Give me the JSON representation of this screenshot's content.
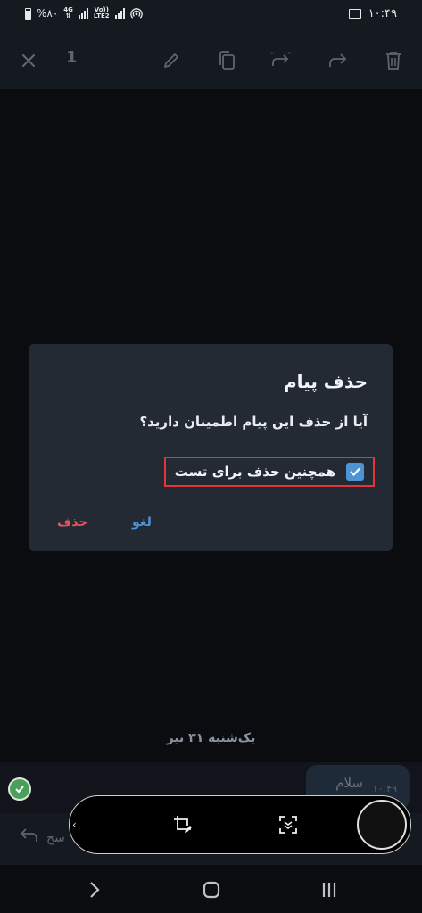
{
  "status_bar": {
    "battery": "%۸۰",
    "network_top": "4G",
    "network_bottom": "",
    "volte_top": "Vo))",
    "volte_bottom": "LTE2",
    "time": "۱۰:۴۹"
  },
  "action_bar": {
    "selection_count": "1"
  },
  "chat": {
    "date_label": "یک‌شنبه ۳۱ تیر",
    "message_text": "سلام",
    "message_time": "۱۰:۴۹",
    "reply_label": "سخ"
  },
  "dialog": {
    "title": "حذف پیام",
    "message": "آیا از حذف این پیام اطمینان دارید؟",
    "option_label": "همچنین حذف برای تست",
    "option_checked": true,
    "cancel_label": "لغو",
    "delete_label": "حذف"
  },
  "colors": {
    "accent": "#4d94d6",
    "danger": "#e5545c",
    "highlight_border": "#e0363a",
    "dialog_bg": "#232a34"
  },
  "icons": {
    "close": "close-icon",
    "edit": "pencil-icon",
    "copy": "copy-icon",
    "forward_quote": "forward-quote-icon",
    "forward": "forward-icon",
    "delete": "trash-icon"
  }
}
